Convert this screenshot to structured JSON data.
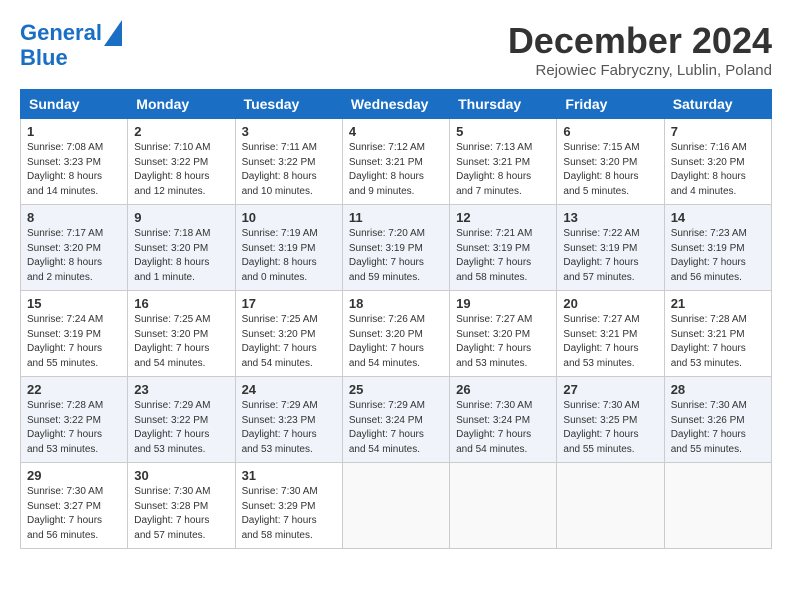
{
  "header": {
    "logo_line1": "General",
    "logo_line2": "Blue",
    "month_title": "December 2024",
    "location": "Rejowiec Fabryczny, Lublin, Poland"
  },
  "days_of_week": [
    "Sunday",
    "Monday",
    "Tuesday",
    "Wednesday",
    "Thursday",
    "Friday",
    "Saturday"
  ],
  "weeks": [
    [
      {
        "day": "1",
        "sunrise": "7:08 AM",
        "sunset": "3:23 PM",
        "daylight": "8 hours and 14 minutes."
      },
      {
        "day": "2",
        "sunrise": "7:10 AM",
        "sunset": "3:22 PM",
        "daylight": "8 hours and 12 minutes."
      },
      {
        "day": "3",
        "sunrise": "7:11 AM",
        "sunset": "3:22 PM",
        "daylight": "8 hours and 10 minutes."
      },
      {
        "day": "4",
        "sunrise": "7:12 AM",
        "sunset": "3:21 PM",
        "daylight": "8 hours and 9 minutes."
      },
      {
        "day": "5",
        "sunrise": "7:13 AM",
        "sunset": "3:21 PM",
        "daylight": "8 hours and 7 minutes."
      },
      {
        "day": "6",
        "sunrise": "7:15 AM",
        "sunset": "3:20 PM",
        "daylight": "8 hours and 5 minutes."
      },
      {
        "day": "7",
        "sunrise": "7:16 AM",
        "sunset": "3:20 PM",
        "daylight": "8 hours and 4 minutes."
      }
    ],
    [
      {
        "day": "8",
        "sunrise": "7:17 AM",
        "sunset": "3:20 PM",
        "daylight": "8 hours and 2 minutes."
      },
      {
        "day": "9",
        "sunrise": "7:18 AM",
        "sunset": "3:20 PM",
        "daylight": "8 hours and 1 minute."
      },
      {
        "day": "10",
        "sunrise": "7:19 AM",
        "sunset": "3:19 PM",
        "daylight": "8 hours and 0 minutes."
      },
      {
        "day": "11",
        "sunrise": "7:20 AM",
        "sunset": "3:19 PM",
        "daylight": "7 hours and 59 minutes."
      },
      {
        "day": "12",
        "sunrise": "7:21 AM",
        "sunset": "3:19 PM",
        "daylight": "7 hours and 58 minutes."
      },
      {
        "day": "13",
        "sunrise": "7:22 AM",
        "sunset": "3:19 PM",
        "daylight": "7 hours and 57 minutes."
      },
      {
        "day": "14",
        "sunrise": "7:23 AM",
        "sunset": "3:19 PM",
        "daylight": "7 hours and 56 minutes."
      }
    ],
    [
      {
        "day": "15",
        "sunrise": "7:24 AM",
        "sunset": "3:19 PM",
        "daylight": "7 hours and 55 minutes."
      },
      {
        "day": "16",
        "sunrise": "7:25 AM",
        "sunset": "3:20 PM",
        "daylight": "7 hours and 54 minutes."
      },
      {
        "day": "17",
        "sunrise": "7:25 AM",
        "sunset": "3:20 PM",
        "daylight": "7 hours and 54 minutes."
      },
      {
        "day": "18",
        "sunrise": "7:26 AM",
        "sunset": "3:20 PM",
        "daylight": "7 hours and 54 minutes."
      },
      {
        "day": "19",
        "sunrise": "7:27 AM",
        "sunset": "3:20 PM",
        "daylight": "7 hours and 53 minutes."
      },
      {
        "day": "20",
        "sunrise": "7:27 AM",
        "sunset": "3:21 PM",
        "daylight": "7 hours and 53 minutes."
      },
      {
        "day": "21",
        "sunrise": "7:28 AM",
        "sunset": "3:21 PM",
        "daylight": "7 hours and 53 minutes."
      }
    ],
    [
      {
        "day": "22",
        "sunrise": "7:28 AM",
        "sunset": "3:22 PM",
        "daylight": "7 hours and 53 minutes."
      },
      {
        "day": "23",
        "sunrise": "7:29 AM",
        "sunset": "3:22 PM",
        "daylight": "7 hours and 53 minutes."
      },
      {
        "day": "24",
        "sunrise": "7:29 AM",
        "sunset": "3:23 PM",
        "daylight": "7 hours and 53 minutes."
      },
      {
        "day": "25",
        "sunrise": "7:29 AM",
        "sunset": "3:24 PM",
        "daylight": "7 hours and 54 minutes."
      },
      {
        "day": "26",
        "sunrise": "7:30 AM",
        "sunset": "3:24 PM",
        "daylight": "7 hours and 54 minutes."
      },
      {
        "day": "27",
        "sunrise": "7:30 AM",
        "sunset": "3:25 PM",
        "daylight": "7 hours and 55 minutes."
      },
      {
        "day": "28",
        "sunrise": "7:30 AM",
        "sunset": "3:26 PM",
        "daylight": "7 hours and 55 minutes."
      }
    ],
    [
      {
        "day": "29",
        "sunrise": "7:30 AM",
        "sunset": "3:27 PM",
        "daylight": "7 hours and 56 minutes."
      },
      {
        "day": "30",
        "sunrise": "7:30 AM",
        "sunset": "3:28 PM",
        "daylight": "7 hours and 57 minutes."
      },
      {
        "day": "31",
        "sunrise": "7:30 AM",
        "sunset": "3:29 PM",
        "daylight": "7 hours and 58 minutes."
      },
      null,
      null,
      null,
      null
    ]
  ],
  "labels": {
    "sunrise": "Sunrise:",
    "sunset": "Sunset:",
    "daylight": "Daylight:"
  }
}
